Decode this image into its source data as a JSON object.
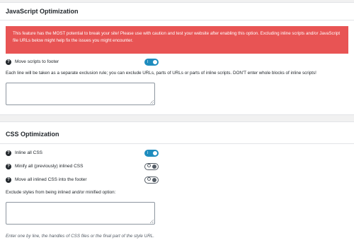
{
  "js_section": {
    "title": "JavaScript Optimization",
    "warning": "This feature has the MOST potential to break your site! Please use with caution and test your website after enabling this option. Excluding inline scripts and/or JavaScript file URLs below might help fix the issues you might encounter.",
    "move_scripts_label": "Move scripts to footer",
    "move_scripts_enabled": true,
    "exclusion_hint": "Each line will be taken as a separate exclusion rule; you can exclude URLs, parts of URLs or parts of inline scripts. DON'T enter whole blocks of inline scripts!",
    "exclusions_value": ""
  },
  "css_section": {
    "title": "CSS Optimization",
    "options": [
      {
        "label": "Inline all CSS",
        "enabled": true
      },
      {
        "label": "Minify all (previously) inlined CSS",
        "enabled": false
      },
      {
        "label": "Move all inlined CSS into the footer",
        "enabled": false
      }
    ],
    "exclude_label": "Exclude styles from being inlined and/or minified option:",
    "exclude_value": "",
    "exclude_hint": "Enter one by line, the handles of CSS files or the final part of the style URL."
  },
  "icons": {
    "help": "question-circle-icon",
    "toggle_on_mark": "I",
    "help_glyph": "?"
  },
  "colors": {
    "warning_bg": "#e85454",
    "toggle_on": "#1e8cbe",
    "toggle_off_border": "#555d66"
  }
}
